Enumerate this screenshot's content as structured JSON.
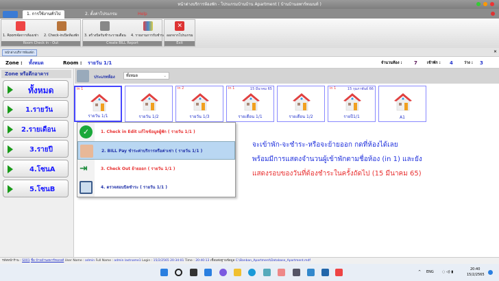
{
  "window": {
    "title": "หน้าต่างบริการห้องพัก - โปรแกรมบ้านบ้าน Apartment ( บ้านบ้านอพาร์ทเมนท์ )"
  },
  "tabs": [
    {
      "label": "1. การใช้งานทั่วไป"
    },
    {
      "label": "2. ตั้งค่าโปรแกรม"
    },
    {
      "label": "Help"
    }
  ],
  "ribbon": {
    "groups": [
      {
        "label": "Room Check in - Out",
        "buttons": [
          {
            "label": "1. Roomจัดการห้องเช่า"
          },
          {
            "label": "2. Check-inเปิดห้องพัก"
          }
        ]
      },
      {
        "label": "Create BILL Report",
        "buttons": [
          {
            "label": "3. สร้างบิลรับชำระรายเดือน"
          },
          {
            "label": "4. รายงานการรับชำระ"
          }
        ]
      },
      {
        "label": "Exit",
        "buttons": [
          {
            "label": "ออกจากโปรแกรม"
          }
        ]
      }
    ]
  },
  "doc_tab": "หน้าต่างบริการห้องพัก",
  "info": {
    "zone_label": "Zone :",
    "zone_value": "ทั้งหมด",
    "room_label": "Room :",
    "room_value": "รายวัน 1/1",
    "total_label": "จำนวนห้อง :",
    "total": "7",
    "occupied_label": "เข้าพัก :",
    "occupied": "4",
    "vacant_label": "ว่าง :",
    "vacant": "3"
  },
  "sidebar": {
    "title": "Zone หรือตึกอาคาร",
    "items": [
      "ทั้งหมด",
      "1.รายวัน",
      "2.รายเดือน",
      "3.รายปี",
      "4.โซนA",
      "5.โซนB"
    ]
  },
  "filter": {
    "label": "ประเภทห้อง",
    "value": "ทั้งหมด"
  },
  "rooms": [
    {
      "name": "รายวัน 1/1",
      "guests": "in 1",
      "due": ""
    },
    {
      "name": "รายวัน 1/2",
      "guests": "",
      "due": ""
    },
    {
      "name": "รายวัน 1/3",
      "guests": "in 2",
      "due": ""
    },
    {
      "name": "รายเดือน 1/1",
      "guests": "in 1",
      "due": "15 มีนาคม 65"
    },
    {
      "name": "รายเดือน 1/2",
      "guests": "",
      "due": ""
    },
    {
      "name": "รายปี1/1",
      "guests": "in 1",
      "due": "15 กุมภาพันธ์ 66"
    },
    {
      "name": "A1",
      "guests": "",
      "due": ""
    }
  ],
  "context_menu": [
    {
      "label": "1. Check in Edit แก้ไขข้อมูลผู้พัก ( รายวัน 1/1 )",
      "color": "#e83030"
    },
    {
      "label": "2. BILL Pay ชำระค่าบริการหรือค่าเช่า ( รายวัน 1/1 )",
      "color": "#2233aa"
    },
    {
      "label": "3. Check Out ย้ายออก ( รายวัน 1/1 )",
      "color": "#e83030"
    },
    {
      "label": "4. ตรวจสอบบิลชำระ ( รายวัน 1/1 )",
      "color": "#2233aa"
    }
  ],
  "note": {
    "line1": "จะเข้าพัก-จะชำระ-หรือจะย้ายออก กดที่ห้องได้เลย",
    "line2": "พร้อมมีการแสดงจำนวนผู้เข้าพักตามชื่อห้อง (in 1) และยัง",
    "line3": "แสดงรอบของวันที่ต้องชำระในครั้งถัดไป (15 มีนาคม 65)"
  },
  "status": {
    "code_label": "รหัสหน้าร้าน :",
    "code": "S001",
    "shop": "ชื่อ บ้านบ้านอพาร์ทเมนท์",
    "user_label": "User Name :",
    "user": "admin",
    "fullname_label": "Full Name :",
    "fullname": "admin lastname1",
    "login_label": "Login :",
    "login": "15/2/2565 20:34:01",
    "time_label": "Time :",
    "time": "20:40:13",
    "db_label": "เชื่อมต่อฐานข้อมูล",
    "db": "C:\\Banban_Apartment\\Database_Apartment.mdf"
  },
  "taskbar": {
    "lang": "ENG",
    "clock_time": "20:40",
    "clock_date": "15/2/2565"
  }
}
